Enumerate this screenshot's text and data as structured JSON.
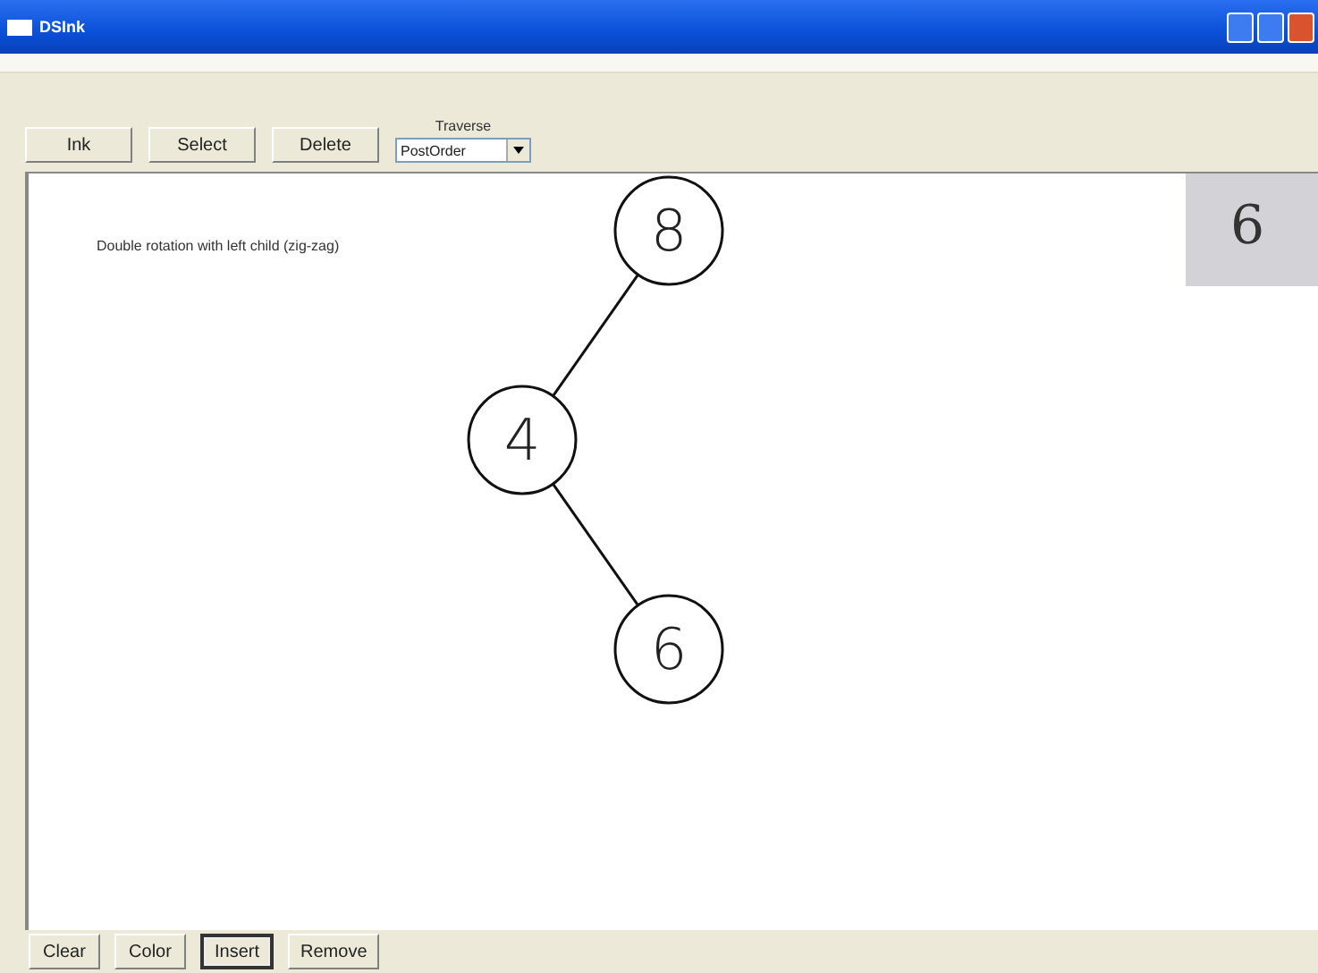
{
  "window": {
    "title": "DSInk"
  },
  "toolbar": {
    "buttons": [
      {
        "label": "Ink",
        "focused": false
      },
      {
        "label": "Select",
        "focused": false
      },
      {
        "label": "Delete",
        "focused": false
      }
    ],
    "traverse": {
      "label": "Traverse",
      "value": "PostOrder"
    }
  },
  "canvas": {
    "caption": "Double rotation with left child (zig-zag)",
    "tree": {
      "label": "8",
      "left": {
        "label": "4",
        "right": {
          "label": "6"
        }
      }
    },
    "preview": {
      "label": "6"
    }
  },
  "bottom_buttons": [
    {
      "label": "Clear",
      "focused": false
    },
    {
      "label": "Color",
      "focused": false
    },
    {
      "label": "Insert",
      "focused": true
    },
    {
      "label": "Remove",
      "focused": false
    }
  ]
}
